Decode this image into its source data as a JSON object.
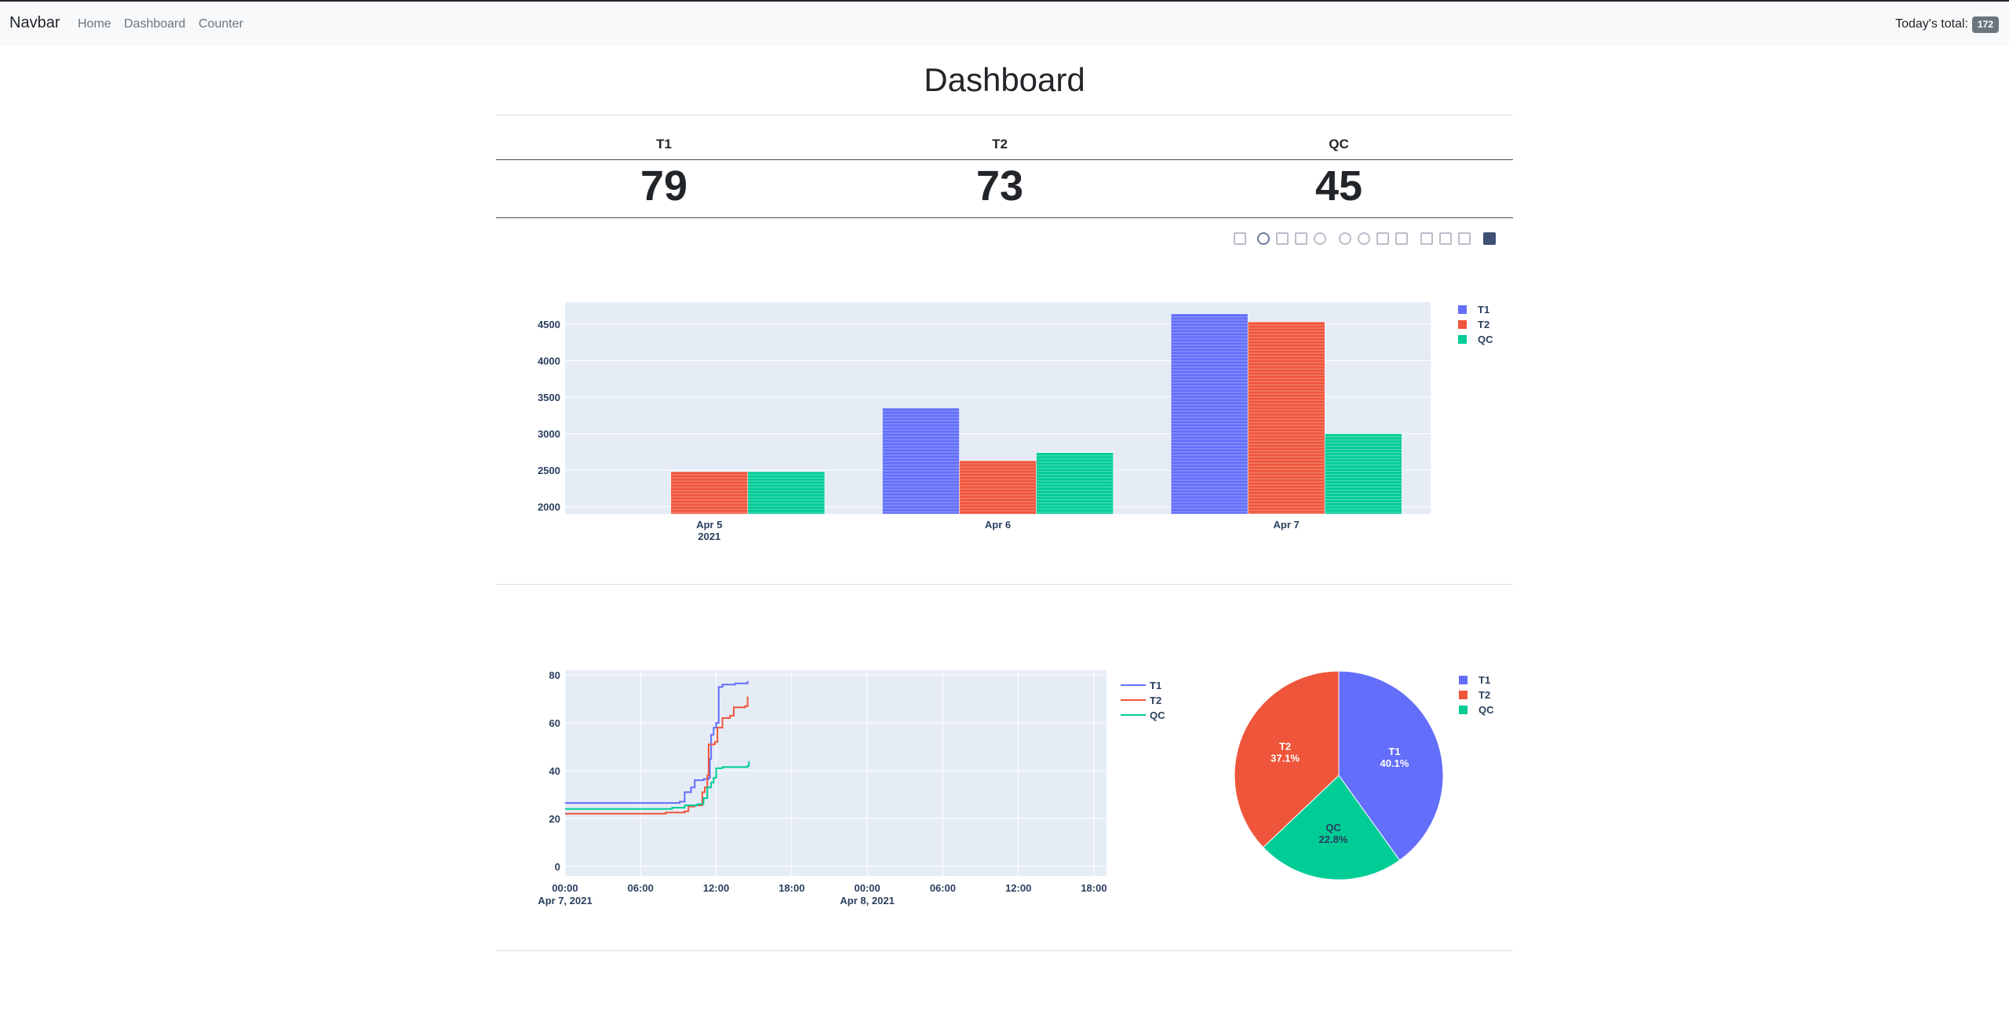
{
  "navbar": {
    "brand": "Navbar",
    "links": [
      "Home",
      "Dashboard",
      "Counter"
    ],
    "total_label": "Today's total:",
    "total_value": "172"
  },
  "page": {
    "title": "Dashboard"
  },
  "stats": [
    {
      "label": "T1",
      "value": "79"
    },
    {
      "label": "T2",
      "value": "73"
    },
    {
      "label": "QC",
      "value": "45"
    }
  ],
  "modebar_icons": [
    "camera-icon",
    "zoom-icon",
    "pan-icon",
    "box-select-icon",
    "lasso-icon",
    "zoom-in-icon",
    "zoom-out-icon",
    "autoscale-icon",
    "reset-axes-icon",
    "spike-lines-icon",
    "hover-closest-icon",
    "hover-compare-icon",
    "plotly-logo-icon"
  ],
  "colors": {
    "T1": "#636efa",
    "T2": "#ef553b",
    "QC": "#00cc96",
    "plot_bg": "#e5ecf6"
  },
  "chart_data": [
    {
      "type": "bar",
      "categories": [
        "Apr 5\n2021",
        "Apr 6",
        "Apr 7"
      ],
      "series": [
        {
          "name": "T1",
          "values": [
            null,
            3350,
            4640
          ]
        },
        {
          "name": "T2",
          "values": [
            2480,
            2630,
            4530
          ]
        },
        {
          "name": "QC",
          "values": [
            2480,
            2740,
            3000
          ]
        }
      ],
      "y_ticks": [
        2000,
        2500,
        3000,
        3500,
        4000,
        4500
      ],
      "ylim": [
        1900,
        4800
      ],
      "legend": "top-right"
    },
    {
      "type": "line",
      "x_ticks": [
        "00:00",
        "06:00",
        "12:00",
        "18:00",
        "00:00",
        "06:00",
        "12:00",
        "18:00"
      ],
      "x_tick_subs": [
        "Apr 7, 2021",
        "",
        "",
        "",
        "Apr 8, 2021",
        "",
        "",
        ""
      ],
      "y_ticks": [
        0,
        20,
        40,
        60,
        80
      ],
      "ylim": [
        -4,
        82
      ],
      "xlim_hours": [
        0,
        43
      ],
      "series": [
        {
          "name": "T1",
          "points": [
            [
              0,
              26.5
            ],
            [
              9.1,
              27
            ],
            [
              9.5,
              31
            ],
            [
              10,
              33
            ],
            [
              10.3,
              36
            ],
            [
              11,
              36.5
            ],
            [
              11.4,
              37
            ],
            [
              11.5,
              45
            ],
            [
              11.6,
              55
            ],
            [
              11.8,
              58
            ],
            [
              12,
              60
            ],
            [
              12.2,
              75
            ],
            [
              12.5,
              76
            ],
            [
              13.5,
              76.5
            ],
            [
              14.5,
              77.5
            ]
          ]
        },
        {
          "name": "T2",
          "points": [
            [
              0,
              22
            ],
            [
              8,
              22.5
            ],
            [
              9.5,
              23
            ],
            [
              9.8,
              25
            ],
            [
              10.3,
              25.5
            ],
            [
              10.9,
              31
            ],
            [
              11.1,
              33
            ],
            [
              11.3,
              38
            ],
            [
              11.4,
              51
            ],
            [
              11.9,
              52
            ],
            [
              12.1,
              58
            ],
            [
              12.5,
              62
            ],
            [
              13.1,
              63
            ],
            [
              13.4,
              66.5
            ],
            [
              14.3,
              67
            ],
            [
              14.5,
              71
            ]
          ]
        },
        {
          "name": "QC",
          "points": [
            [
              0,
              24
            ],
            [
              8.5,
              24.5
            ],
            [
              9.5,
              25.5
            ],
            [
              10.5,
              26
            ],
            [
              11,
              28.5
            ],
            [
              11.3,
              33
            ],
            [
              11.6,
              35
            ],
            [
              11.8,
              37
            ],
            [
              12,
              41
            ],
            [
              12.5,
              41.5
            ],
            [
              14.5,
              42
            ],
            [
              14.6,
              44
            ]
          ]
        }
      ],
      "legend": "top-right"
    },
    {
      "type": "pie",
      "slices": [
        {
          "name": "T1",
          "label": "40.1%",
          "value": 40.1
        },
        {
          "name": "QC",
          "label": "22.8%",
          "value": 22.8
        },
        {
          "name": "T2",
          "label": "37.1%",
          "value": 37.1
        }
      ],
      "legend": "top-right"
    }
  ]
}
